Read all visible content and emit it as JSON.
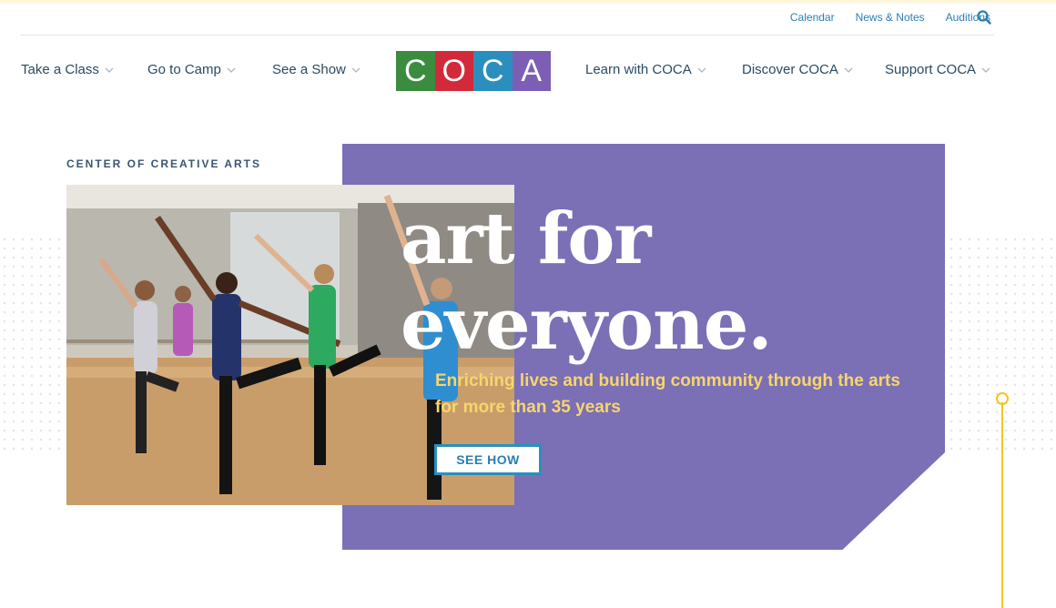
{
  "utility_nav": [
    "Calendar",
    "News & Notes",
    "Auditions"
  ],
  "main_nav": {
    "left": [
      "Take a Class",
      "Go to Camp",
      "See a Show"
    ],
    "right": [
      "Learn with COCA",
      "Discover COCA",
      "Support COCA"
    ]
  },
  "logo": {
    "letters": [
      "C",
      "O",
      "C",
      "A"
    ],
    "colors": [
      "#3b8c3e",
      "#d22a3a",
      "#2b8fbe",
      "#7c5fb5"
    ]
  },
  "hero": {
    "kicker": "CENTER OF CREATIVE ARTS",
    "headline_line1": "art for",
    "headline_line2": "everyone.",
    "subtitle": "Enriching lives and building community through the arts for more than 35 years",
    "cta": "SEE HOW"
  },
  "colors": {
    "panel": "#7b6fb5",
    "accent_yellow": "#f2c623",
    "link_blue": "#2a7fb3",
    "nav_text": "#2b4a62"
  },
  "icons": [
    "search-icon",
    "chevron-down-icon"
  ]
}
